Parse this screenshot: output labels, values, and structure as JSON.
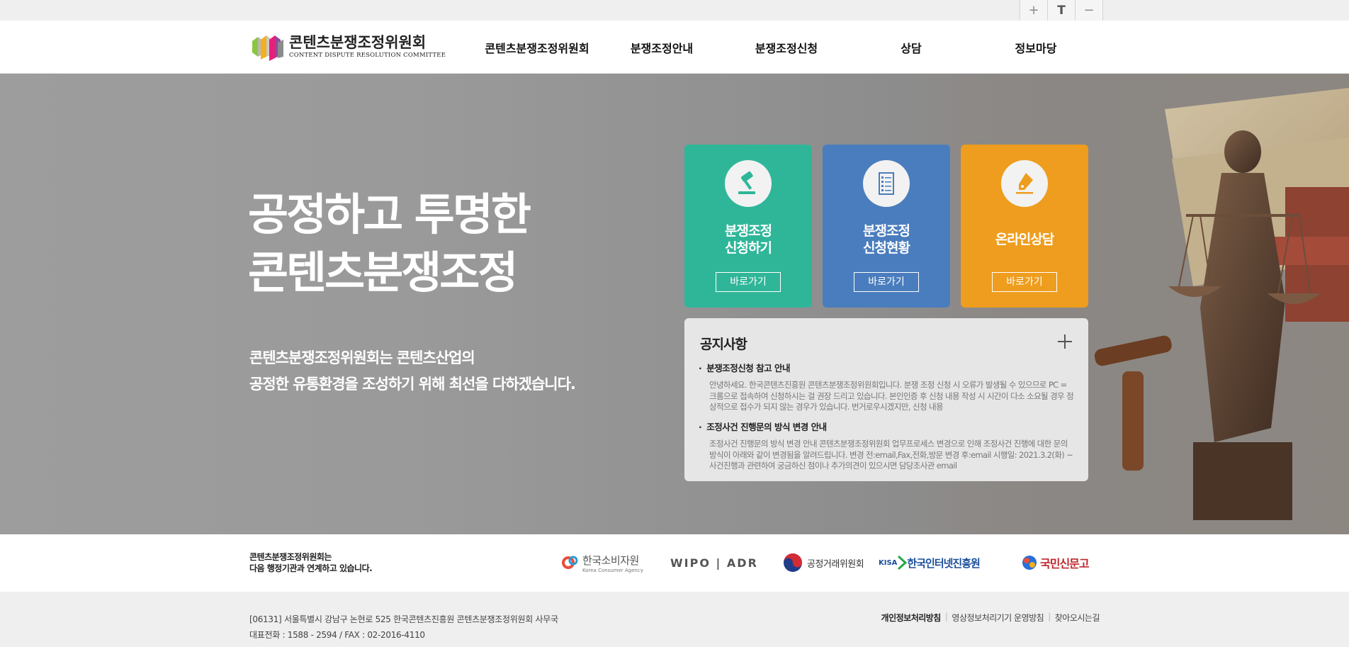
{
  "utility": {
    "zoom_in": "+",
    "text_size": "T",
    "zoom_out": "−"
  },
  "header": {
    "logo_ko": "콘텐츠분쟁조정위원회",
    "logo_en": "CONTENT DISPUTE RESOLUTION COMMITTEE",
    "nav": [
      {
        "label": "콘텐츠분쟁조정위원회"
      },
      {
        "label": "분쟁조정안내"
      },
      {
        "label": "분쟁조정신청"
      },
      {
        "label": "상담"
      },
      {
        "label": "정보마당"
      }
    ]
  },
  "hero": {
    "title_line1": "공정하고 투명한",
    "title_line2": "콘텐츠분쟁조정",
    "sub_line1": "콘텐츠분쟁조정위원회는 콘텐츠산업의",
    "sub_line2": "공정한 유통환경을 조성하기 위해 최선을 다하겠습니다."
  },
  "cards": [
    {
      "line1": "분쟁조정",
      "line2": "신청하기",
      "button": "바로가기",
      "icon": "gavel-icon",
      "color": "#2fb699"
    },
    {
      "line1": "분쟁조정",
      "line2": "신청현황",
      "button": "바로가기",
      "icon": "document-list-icon",
      "color": "#4a7dbd"
    },
    {
      "line1": "온라인상담",
      "line2": "",
      "button": "바로가기",
      "icon": "pen-icon",
      "color": "#ee9d1e"
    }
  ],
  "notice": {
    "title": "공지사항",
    "more_icon": "plus-icon",
    "items": [
      {
        "title": "분쟁조정신청 참고 안내",
        "body": "안녕하세요. 한국콘텐츠진흥원 콘텐츠분쟁조정위원회입니다. 분쟁 조정 신청 시 오류가 발생될 수 있으므로 PC = 크롬으로 접속하여 신청하시는 걸 권장 드리고 있습니다. 본인인증 후 신청 내용 작성 시 시간이 다소 소요될 경우 정상적으로 접수가 되지 않는 경우가 있습니다. 번거로우시겠지만, 신청 내용"
      },
      {
        "title": "조정사건 진행문의 방식 변경 안내",
        "body": "조정사건 진행문의 방식 변경 안내 콘텐츠분쟁조정위원회 업무프로세스 변경으로 인해 조정사건 진행에 대한 문의방식이 아래와 같이 변경됨을 알려드립니다. 변경 전:email,Fax,전화,방문 변경 후:email 시행일: 2021.3.2(화) ~ 사건진행과 관련하여 궁금하신 점이나 추가의견이 있으시면 담당조사관 email"
      }
    ]
  },
  "partners": {
    "intro_line1": "콘텐츠분쟁조정위원회는",
    "intro_line2": "다음 행정기관과 연계하고 있습니다.",
    "list": [
      {
        "name": "한국소비자원",
        "sub": "Korea Consumer Agency"
      },
      {
        "name": "WIPO | ADR"
      },
      {
        "name": "공정거래위원회"
      },
      {
        "name": "한국인터넷진흥원",
        "prefix": "KISA"
      },
      {
        "name": "국민신문고"
      }
    ]
  },
  "footer": {
    "address": "[06131] 서울특별시 강남구 논현로 525 한국콘텐츠진흥원 콘텐츠분쟁조정위원회 사무국",
    "phone": "대표전화 : 1588 - 2594 / FAX : 02-2016-4110",
    "links": [
      "개인정보처리방침",
      "영상정보처리기기 운영방침",
      "찾아오시는길"
    ]
  }
}
